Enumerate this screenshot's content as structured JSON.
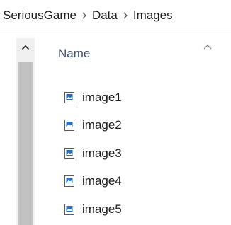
{
  "breadcrumb": {
    "items": [
      {
        "label": "SeriousGame"
      },
      {
        "label": "Data"
      },
      {
        "label": "Images"
      }
    ]
  },
  "columns": {
    "name_label": "Name"
  },
  "files": [
    {
      "name": "image1",
      "icon": "image-file-icon"
    },
    {
      "name": "image2",
      "icon": "image-file-icon"
    },
    {
      "name": "image3",
      "icon": "image-file-icon"
    },
    {
      "name": "image4",
      "icon": "image-file-icon"
    },
    {
      "name": "image5",
      "icon": "image-file-icon"
    }
  ],
  "colors": {
    "icon_accent": "#2b6cb8",
    "header_text": "#3c4f6b",
    "scroll_thumb": "#c2c2c2"
  }
}
